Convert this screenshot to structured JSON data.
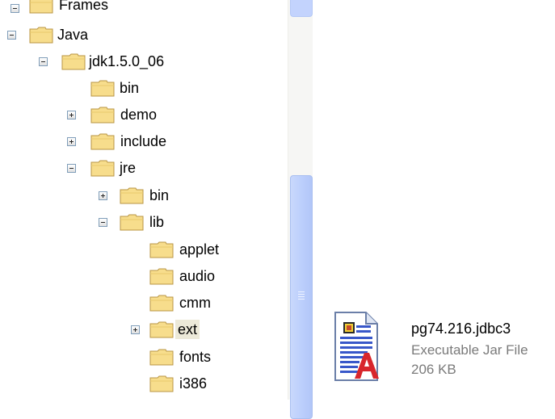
{
  "tree": {
    "items": [
      {
        "label": "Frames",
        "expander": "minus"
      },
      {
        "label": "Java",
        "expander": "minus"
      },
      {
        "label": "jdk1.5.0_06",
        "expander": "minus"
      },
      {
        "label": "bin",
        "expander": "none"
      },
      {
        "label": "demo",
        "expander": "plus"
      },
      {
        "label": "include",
        "expander": "plus"
      },
      {
        "label": "jre",
        "expander": "minus"
      },
      {
        "label": "bin",
        "expander": "plus"
      },
      {
        "label": "lib",
        "expander": "minus"
      },
      {
        "label": "applet",
        "expander": "none"
      },
      {
        "label": "audio",
        "expander": "none"
      },
      {
        "label": "cmm",
        "expander": "none"
      },
      {
        "label": "ext",
        "expander": "plus",
        "selected": true
      },
      {
        "label": "fonts",
        "expander": "none"
      },
      {
        "label": "i386",
        "expander": "none"
      }
    ]
  },
  "file": {
    "name": "pg74.216.jdbc3",
    "type": "Executable Jar File",
    "size": "206 KB",
    "icon": "jar-file-icon"
  },
  "colors": {
    "folder_fill": "#f7dd8c",
    "folder_stroke": "#b89543",
    "selection": "#ece9d8",
    "scroll_thumb": "#c3d3fd"
  }
}
